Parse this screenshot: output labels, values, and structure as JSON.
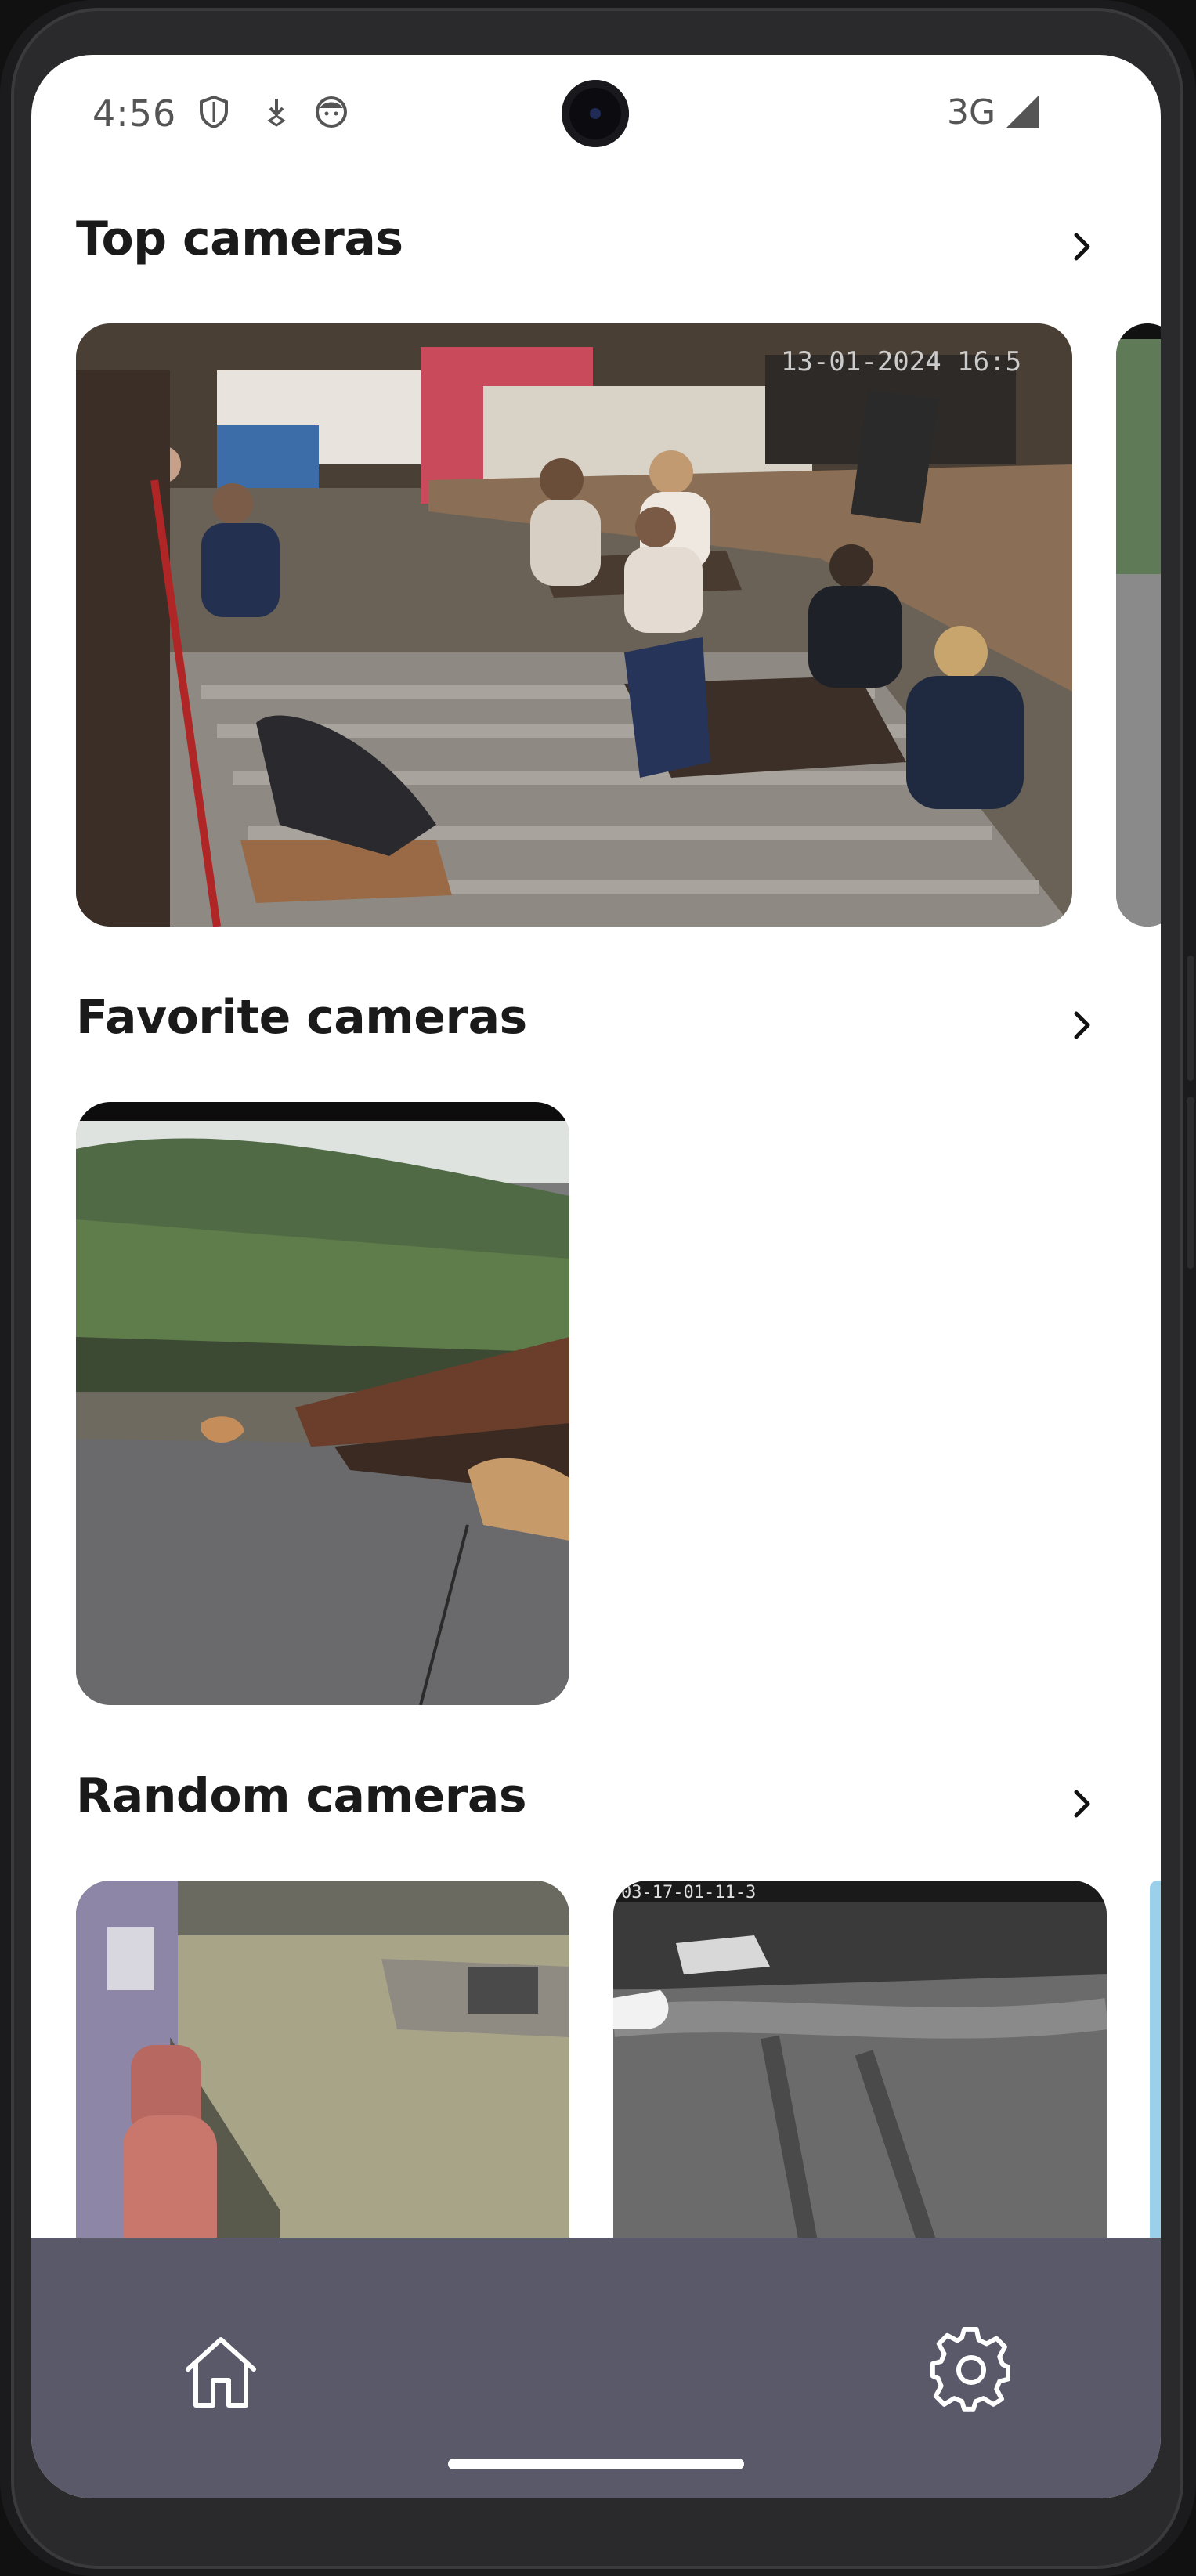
{
  "status_bar": {
    "time": "4:56",
    "icons": [
      "shield-icon",
      "download-icon",
      "face-icon"
    ],
    "network": "3G",
    "signal_icon": "signal-icon"
  },
  "sections": {
    "top": {
      "title": "Top cameras"
    },
    "favorite": {
      "title": "Favorite cameras"
    },
    "random": {
      "title": "Random cameras"
    }
  },
  "camera_feeds": {
    "top_main": {
      "overlay_timestamp": "13-01-2024 16:5"
    },
    "random_second": {
      "overlay_timestamp": "03-17-01-11-3"
    }
  },
  "bottom_nav": {
    "items": [
      "home-icon",
      "settings-icon"
    ]
  },
  "colors": {
    "background": "#ffffff",
    "nav_bar": "#5a5969",
    "text": "#1a1a1a"
  }
}
